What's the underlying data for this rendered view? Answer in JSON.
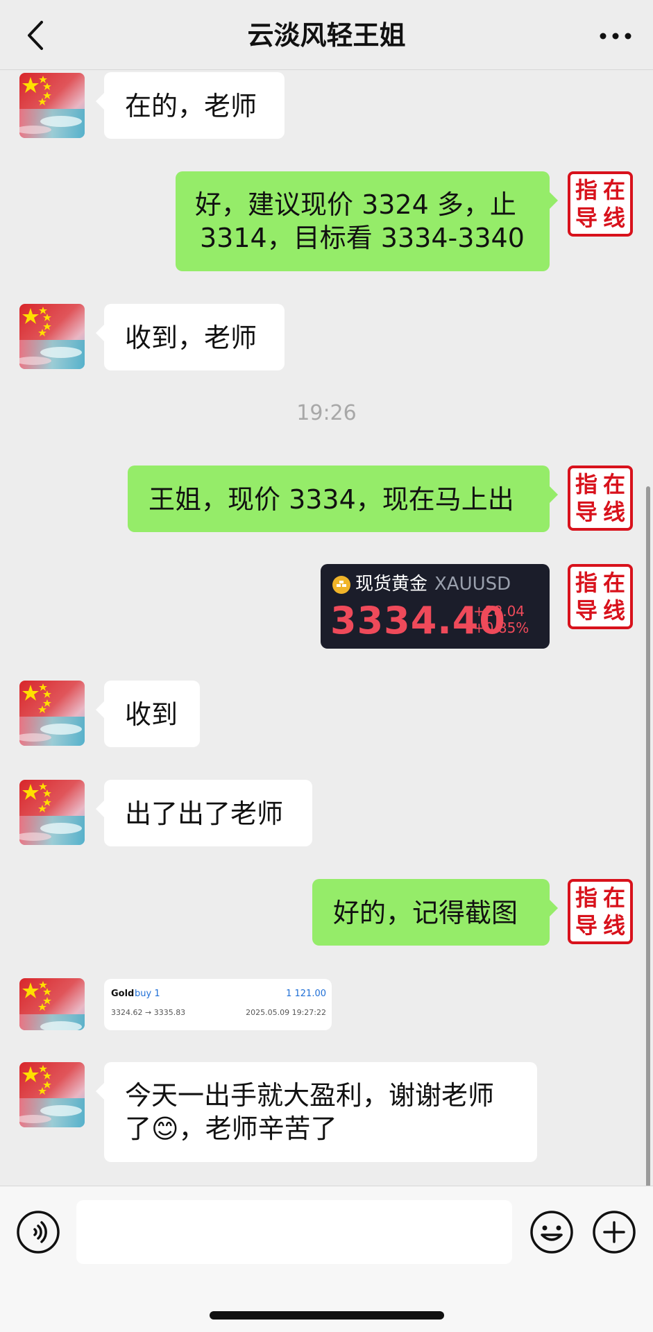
{
  "header": {
    "title": "云淡风轻王姐"
  },
  "seal_text": [
    "指",
    "在",
    "导",
    "线"
  ],
  "messages": {
    "m1": "在的，老师",
    "m2_line1": "好，建议现价 3324 多，止",
    "m2_line2": "3314，目标看 3334-3340",
    "m3": "收到，老师",
    "time": "19:26",
    "m4": "王姐，现价 3334，现在马上出",
    "m6": "收到",
    "m7": "出了出了老师",
    "m8": "好的，记得截图",
    "m10_line1": "今天一出手就大盈利，谢谢老师",
    "m10_line2_a": "了",
    "m10_emoji": "😊",
    "m10_line2_b": "，老师辛苦了"
  },
  "quote_card": {
    "name": "现货黄金",
    "symbol": "XAUUSD",
    "price": "3334.40",
    "change": "+28.04",
    "change_pct": "+0.85%",
    "price_color": "#ef4a5a"
  },
  "trade_card": {
    "symbol": "Gold",
    "side": "buy 1",
    "profit": "1 121.00",
    "prices": "3324.62 → 3335.83",
    "time": "2025.05.09 19:27:22"
  },
  "input": {
    "value": "",
    "placeholder": ""
  },
  "colors": {
    "sent_bubble": "#95ec69",
    "received_bubble": "#ffffff",
    "background": "#ededed",
    "seal_red": "#d8121c"
  }
}
